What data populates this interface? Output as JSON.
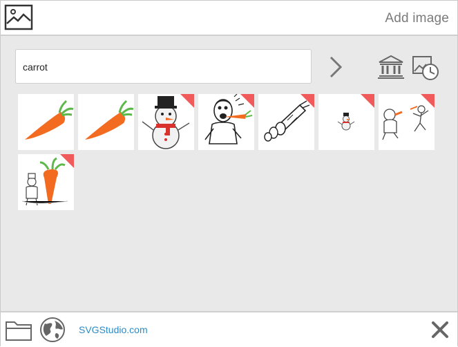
{
  "header": {
    "title": "Add image",
    "icon": "image-icon"
  },
  "search": {
    "value": "carrot",
    "placeholder": ""
  },
  "toolbar": {
    "go_icon": "chevron-right-icon",
    "library_icon": "museum-icon",
    "history_icon": "history-icon"
  },
  "results": [
    {
      "subject": "carrot",
      "premium": false
    },
    {
      "subject": "carrot",
      "premium": false
    },
    {
      "subject": "snowman",
      "premium": true
    },
    {
      "subject": "man-eating-carrot",
      "premium": true
    },
    {
      "subject": "cut-carrot",
      "premium": true
    },
    {
      "subject": "small-snowman",
      "premium": true
    },
    {
      "subject": "running-figure",
      "premium": true
    },
    {
      "subject": "chef-with-carrot",
      "premium": true
    }
  ],
  "footer": {
    "link_text": "SVGStudio.com",
    "folder_icon": "folder-icon",
    "globe_icon": "globe-icon",
    "close_icon": "close-icon"
  },
  "colors": {
    "accent_link": "#2a8bc8",
    "ribbon": "#f05a5a",
    "carrot": "#f26b21",
    "leaves": "#5db84a"
  }
}
